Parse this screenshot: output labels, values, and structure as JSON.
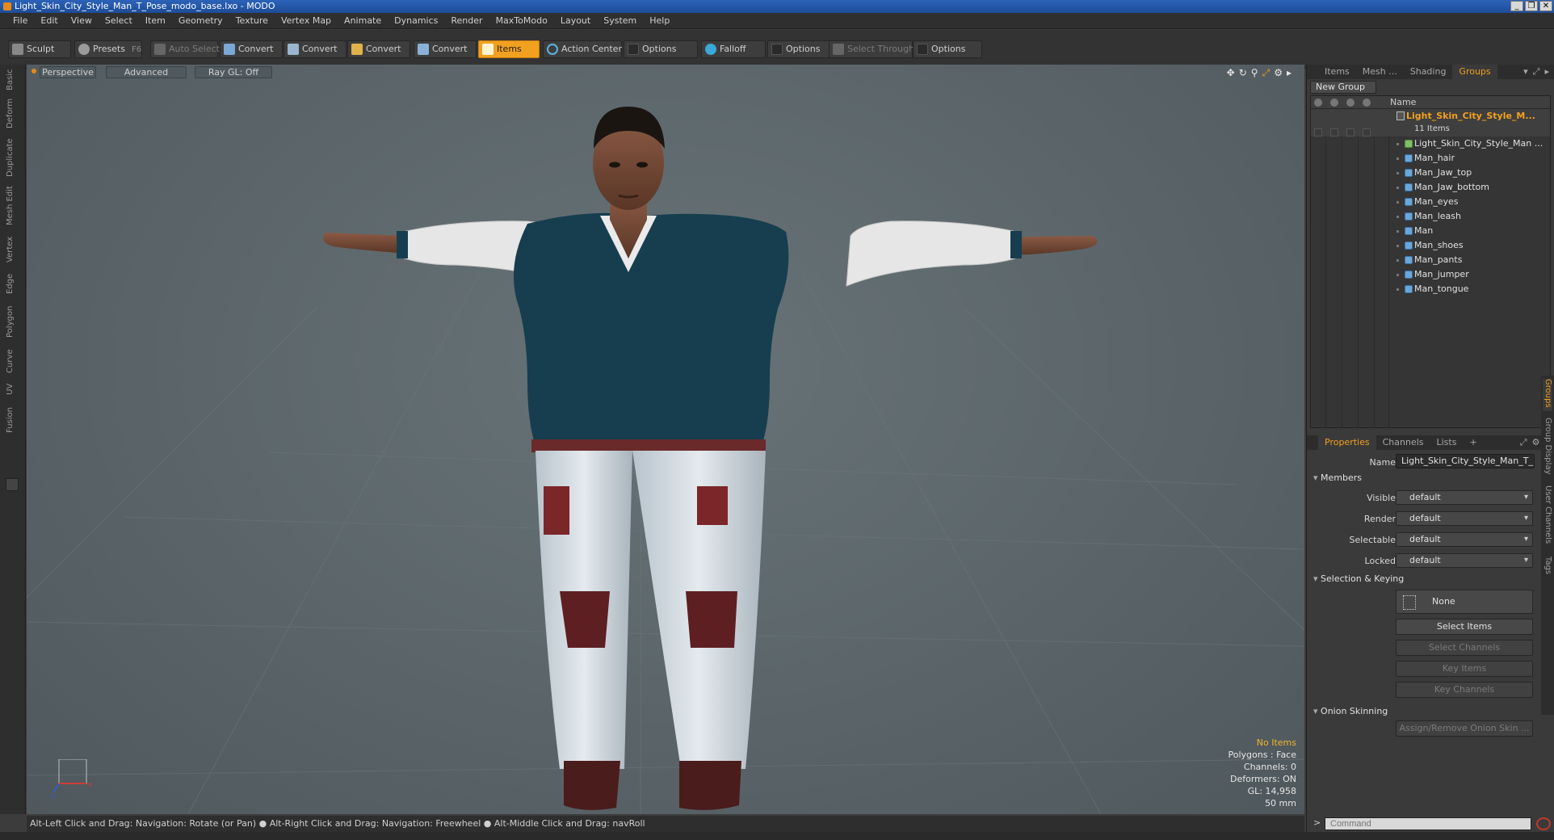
{
  "window": {
    "title": "Light_Skin_City_Style_Man_T_Pose_modo_base.lxo - MODO",
    "controls": [
      "_",
      "❐",
      "✕"
    ]
  },
  "menu": [
    "File",
    "Edit",
    "View",
    "Select",
    "Item",
    "Geometry",
    "Texture",
    "Vertex Map",
    "Animate",
    "Dynamics",
    "Render",
    "MaxToModo",
    "Layout",
    "System",
    "Help"
  ],
  "toolbar": {
    "sculpt": "Sculpt",
    "presets": "Presets",
    "presets_hotkey": "F6",
    "auto_select": "Auto Select",
    "convert_1": "Convert",
    "convert_2": "Convert",
    "convert_3": "Convert",
    "convert_4": "Convert",
    "items": "Items",
    "action_center": "Action Center",
    "options_1": "Options",
    "falloff": "Falloff",
    "options_2": "Options",
    "select_through": "Select Through",
    "options_3": "Options"
  },
  "left_tabs": [
    "Basic",
    "Deform",
    "Duplicate",
    "Mesh Edit",
    "Vertex",
    "Edge",
    "Polygon",
    "Curve",
    "UV",
    "Fusion"
  ],
  "viewport": {
    "view": "Perspective",
    "shading": "Advanced",
    "raygl": "Ray GL: Off",
    "info": {
      "selection": "No Items",
      "polygons": "Polygons : Face",
      "channels": "Channels: 0",
      "deformers": "Deformers: ON",
      "gl": "GL: 14,958",
      "size": "50 mm"
    }
  },
  "statusbar": "Alt-Left Click and Drag: Navigation: Rotate (or Pan) ● Alt-Right Click and Drag: Navigation: Freewheel ● Alt-Middle Click and Drag: navRoll",
  "top_tabs": [
    "Items",
    "Mesh ...",
    "Shading",
    "Groups"
  ],
  "groups_panel": {
    "new_group": "New Group",
    "name_header": "Name",
    "group_name": "Light_Skin_City_Style_M...",
    "group_count": "11 Items",
    "items": [
      "Light_Skin_City_Style_Man ...",
      "Man_hair",
      "Man_Jaw_top",
      "Man_Jaw_bottom",
      "Man_eyes",
      "Man_leash",
      "Man",
      "Man_shoes",
      "Man_pants",
      "Man_jumper",
      "Man_tongue"
    ]
  },
  "props_tabs": [
    "Properties",
    "Channels",
    "Lists",
    "+"
  ],
  "properties": {
    "name_label": "Name",
    "name_value": "Light_Skin_City_Style_Man_T_Pc",
    "members_section": "Members",
    "visible_label": "Visible",
    "visible_value": "default",
    "render_label": "Render",
    "render_value": "default",
    "selectable_label": "Selectable",
    "selectable_value": "default",
    "locked_label": "Locked",
    "locked_value": "default",
    "selkey_section": "Selection & Keying",
    "none_label": "None",
    "select_items": "Select Items",
    "select_channels": "Select Channels",
    "key_items": "Key Items",
    "key_channels": "Key Channels",
    "onion_section": "Onion Skinning",
    "assign_onion": "Assign/Remove Onion Skin ..."
  },
  "side_tabs": [
    "Groups",
    "Group Display",
    "User Channels",
    "Tags"
  ],
  "command": {
    "prompt": ">",
    "placeholder": "Command"
  },
  "colors": {
    "accent": "#f2a01f",
    "viewport_bg": "#5b6569"
  }
}
